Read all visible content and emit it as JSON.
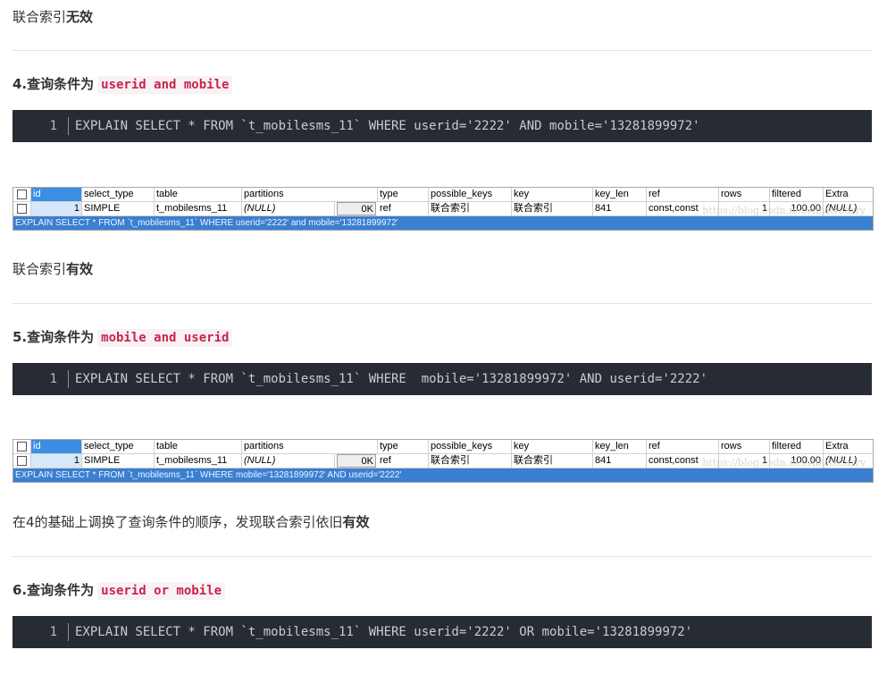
{
  "sections": {
    "p1": {
      "plain": "联合索引",
      "bold": "无效"
    },
    "h4": {
      "label": "4.查询条件为",
      "code": "userid and mobile"
    },
    "code4": {
      "line": "1",
      "text": "EXPLAIN SELECT * FROM `t_mobilesms_11` WHERE userid='2222' AND mobile='13281899972'"
    },
    "grid4": {
      "status": "EXPLAIN SELECT * FROM `t_mobilesms_11` WHERE userid='2222' and mobile='13281899972'"
    },
    "p2": {
      "plain": "联合索引",
      "bold": "有效"
    },
    "h5": {
      "label": "5.查询条件为",
      "code": "mobile and userid"
    },
    "code5": {
      "line": "1",
      "text": "EXPLAIN SELECT * FROM `t_mobilesms_11` WHERE  mobile='13281899972' AND userid='2222'"
    },
    "grid5": {
      "status": "EXPLAIN SELECT * FROM `t_mobilesms_11` WHERE mobile='13281899972' AND userid='2222'"
    },
    "p3": {
      "plain": "在4的基础上调换了查询条件的顺序，发现联合索引依旧",
      "bold": "有效"
    },
    "h6": {
      "label": "6.查询条件为",
      "code": "userid or mobile"
    },
    "code6": {
      "line": "1",
      "text": "EXPLAIN SELECT * FROM `t_mobilesms_11` WHERE userid='2222' OR mobile='13281899972'"
    }
  },
  "grid_columns": [
    "id",
    "select_type",
    "table",
    "partitions",
    "type",
    "possible_keys",
    "key",
    "key_len",
    "ref",
    "rows",
    "filtered",
    "Extra"
  ],
  "grid_row": {
    "id": "1",
    "select_type": "SIMPLE",
    "table": "t_mobilesms_11",
    "partitions": "(NULL)",
    "ok": "0K",
    "type": "ref",
    "possible_keys": "联合索引",
    "key": "联合索引",
    "key_len": "841",
    "ref": "const,const",
    "rows": "1",
    "filtered": "100.00",
    "Extra": "(NULL)"
  },
  "watermark": "https://blog.csdn.net/AbyssCarry"
}
